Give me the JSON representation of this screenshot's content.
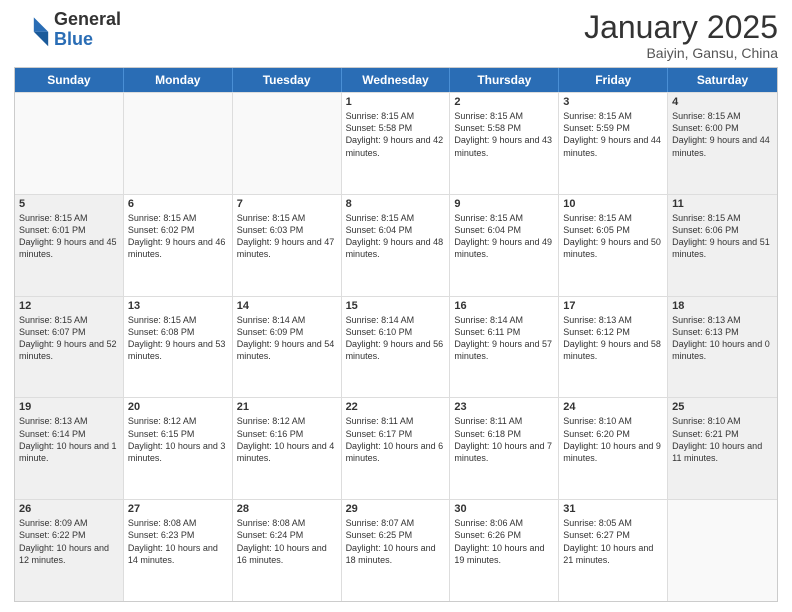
{
  "logo": {
    "general": "General",
    "blue": "Blue"
  },
  "title": "January 2025",
  "location": "Baiyin, Gansu, China",
  "days": [
    "Sunday",
    "Monday",
    "Tuesday",
    "Wednesday",
    "Thursday",
    "Friday",
    "Saturday"
  ],
  "rows": [
    [
      {
        "day": "",
        "empty": true
      },
      {
        "day": "",
        "empty": true
      },
      {
        "day": "",
        "empty": true
      },
      {
        "day": "1",
        "sunrise": "8:15 AM",
        "sunset": "5:58 PM",
        "daylight": "9 hours and 42 minutes."
      },
      {
        "day": "2",
        "sunrise": "8:15 AM",
        "sunset": "5:58 PM",
        "daylight": "9 hours and 43 minutes."
      },
      {
        "day": "3",
        "sunrise": "8:15 AM",
        "sunset": "5:59 PM",
        "daylight": "9 hours and 44 minutes."
      },
      {
        "day": "4",
        "sunrise": "8:15 AM",
        "sunset": "6:00 PM",
        "daylight": "9 hours and 44 minutes.",
        "shaded": true
      }
    ],
    [
      {
        "day": "5",
        "sunrise": "8:15 AM",
        "sunset": "6:01 PM",
        "daylight": "9 hours and 45 minutes.",
        "shaded": true
      },
      {
        "day": "6",
        "sunrise": "8:15 AM",
        "sunset": "6:02 PM",
        "daylight": "9 hours and 46 minutes."
      },
      {
        "day": "7",
        "sunrise": "8:15 AM",
        "sunset": "6:03 PM",
        "daylight": "9 hours and 47 minutes."
      },
      {
        "day": "8",
        "sunrise": "8:15 AM",
        "sunset": "6:04 PM",
        "daylight": "9 hours and 48 minutes."
      },
      {
        "day": "9",
        "sunrise": "8:15 AM",
        "sunset": "6:04 PM",
        "daylight": "9 hours and 49 minutes."
      },
      {
        "day": "10",
        "sunrise": "8:15 AM",
        "sunset": "6:05 PM",
        "daylight": "9 hours and 50 minutes."
      },
      {
        "day": "11",
        "sunrise": "8:15 AM",
        "sunset": "6:06 PM",
        "daylight": "9 hours and 51 minutes.",
        "shaded": true
      }
    ],
    [
      {
        "day": "12",
        "sunrise": "8:15 AM",
        "sunset": "6:07 PM",
        "daylight": "9 hours and 52 minutes.",
        "shaded": true
      },
      {
        "day": "13",
        "sunrise": "8:15 AM",
        "sunset": "6:08 PM",
        "daylight": "9 hours and 53 minutes."
      },
      {
        "day": "14",
        "sunrise": "8:14 AM",
        "sunset": "6:09 PM",
        "daylight": "9 hours and 54 minutes."
      },
      {
        "day": "15",
        "sunrise": "8:14 AM",
        "sunset": "6:10 PM",
        "daylight": "9 hours and 56 minutes."
      },
      {
        "day": "16",
        "sunrise": "8:14 AM",
        "sunset": "6:11 PM",
        "daylight": "9 hours and 57 minutes."
      },
      {
        "day": "17",
        "sunrise": "8:13 AM",
        "sunset": "6:12 PM",
        "daylight": "9 hours and 58 minutes."
      },
      {
        "day": "18",
        "sunrise": "8:13 AM",
        "sunset": "6:13 PM",
        "daylight": "10 hours and 0 minutes.",
        "shaded": true
      }
    ],
    [
      {
        "day": "19",
        "sunrise": "8:13 AM",
        "sunset": "6:14 PM",
        "daylight": "10 hours and 1 minute.",
        "shaded": true
      },
      {
        "day": "20",
        "sunrise": "8:12 AM",
        "sunset": "6:15 PM",
        "daylight": "10 hours and 3 minutes."
      },
      {
        "day": "21",
        "sunrise": "8:12 AM",
        "sunset": "6:16 PM",
        "daylight": "10 hours and 4 minutes."
      },
      {
        "day": "22",
        "sunrise": "8:11 AM",
        "sunset": "6:17 PM",
        "daylight": "10 hours and 6 minutes."
      },
      {
        "day": "23",
        "sunrise": "8:11 AM",
        "sunset": "6:18 PM",
        "daylight": "10 hours and 7 minutes."
      },
      {
        "day": "24",
        "sunrise": "8:10 AM",
        "sunset": "6:20 PM",
        "daylight": "10 hours and 9 minutes."
      },
      {
        "day": "25",
        "sunrise": "8:10 AM",
        "sunset": "6:21 PM",
        "daylight": "10 hours and 11 minutes.",
        "shaded": true
      }
    ],
    [
      {
        "day": "26",
        "sunrise": "8:09 AM",
        "sunset": "6:22 PM",
        "daylight": "10 hours and 12 minutes.",
        "shaded": true
      },
      {
        "day": "27",
        "sunrise": "8:08 AM",
        "sunset": "6:23 PM",
        "daylight": "10 hours and 14 minutes."
      },
      {
        "day": "28",
        "sunrise": "8:08 AM",
        "sunset": "6:24 PM",
        "daylight": "10 hours and 16 minutes."
      },
      {
        "day": "29",
        "sunrise": "8:07 AM",
        "sunset": "6:25 PM",
        "daylight": "10 hours and 18 minutes."
      },
      {
        "day": "30",
        "sunrise": "8:06 AM",
        "sunset": "6:26 PM",
        "daylight": "10 hours and 19 minutes."
      },
      {
        "day": "31",
        "sunrise": "8:05 AM",
        "sunset": "6:27 PM",
        "daylight": "10 hours and 21 minutes."
      },
      {
        "day": "",
        "empty": true,
        "shaded": true
      }
    ]
  ]
}
